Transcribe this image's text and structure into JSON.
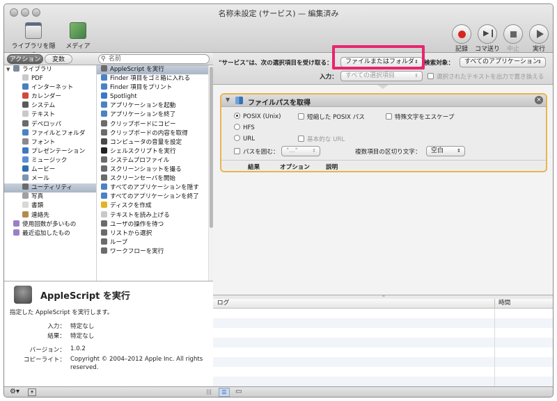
{
  "window": {
    "title": "名称未設定 (サービス) — 編集済み"
  },
  "toolbar": {
    "hide_library_label": "ライブラリを隠す",
    "media_label": "メディア",
    "record_label": "記録",
    "step_label": "コマ送り",
    "stop_label": "中止",
    "run_label": "実行"
  },
  "library": {
    "actions_tab": "アクション",
    "variables_tab": "変数",
    "search_placeholder": "名前",
    "categories": [
      {
        "label": "ライブラリ",
        "icon": "library-icon",
        "color": "#7c8aa0"
      },
      {
        "label": "PDF",
        "icon": "pdf-icon",
        "color": "#c9c9c9"
      },
      {
        "label": "インターネット",
        "icon": "internet-icon",
        "color": "#4a7fc1"
      },
      {
        "label": "カレンダー",
        "icon": "calendar-icon",
        "color": "#d04a3a"
      },
      {
        "label": "システム",
        "icon": "system-icon",
        "color": "#5a5a5a"
      },
      {
        "label": "テキスト",
        "icon": "text-icon",
        "color": "#c9c9c9"
      },
      {
        "label": "デベロッパ",
        "icon": "developer-icon",
        "color": "#6b6b6b"
      },
      {
        "label": "ファイルとフォルダ",
        "icon": "finder-icon",
        "color": "#4b82c4"
      },
      {
        "label": "フォント",
        "icon": "font-icon",
        "color": "#8a8a8a"
      },
      {
        "label": "プレゼンテーション",
        "icon": "presentation-icon",
        "color": "#3f78c2"
      },
      {
        "label": "ミュージック",
        "icon": "music-icon",
        "color": "#5a8fd6"
      },
      {
        "label": "ムービー",
        "icon": "movie-icon",
        "color": "#2d6eb0"
      },
      {
        "label": "メール",
        "icon": "mail-icon",
        "color": "#7d94b5"
      },
      {
        "label": "ユーティリティ",
        "icon": "utility-icon",
        "color": "#6b6b6b"
      },
      {
        "label": "写真",
        "icon": "photo-icon",
        "color": "#a0a0a0"
      },
      {
        "label": "書類",
        "icon": "document-icon",
        "color": "#d8d8d8"
      },
      {
        "label": "連絡先",
        "icon": "contacts-icon",
        "color": "#b58a4a"
      },
      {
        "label": "使用回数が多いもの",
        "icon": "smart-folder-icon",
        "color": "#9b7fc6"
      },
      {
        "label": "最近追加したもの",
        "icon": "smart-folder-icon",
        "color": "#9b7fc6"
      }
    ],
    "selected_category": "ユーティリティ",
    "actions": [
      {
        "label": "AppleScript を実行",
        "icon": "applescript-icon",
        "color": "#6b6b6b"
      },
      {
        "label": "Finder 項目をゴミ箱に入れる",
        "icon": "finder-icon",
        "color": "#4b82c4"
      },
      {
        "label": "Finder 項目をプリント",
        "icon": "finder-icon",
        "color": "#4b82c4"
      },
      {
        "label": "Spotlight",
        "icon": "spotlight-icon",
        "color": "#3b78c9"
      },
      {
        "label": "アプリケーションを起動",
        "icon": "finder-icon",
        "color": "#4b82c4"
      },
      {
        "label": "アプリケーションを終了",
        "icon": "finder-icon",
        "color": "#4b82c4"
      },
      {
        "label": "クリップボードにコピー",
        "icon": "tools-icon",
        "color": "#6b6b6b"
      },
      {
        "label": "クリップボードの内容を取得",
        "icon": "tools-icon",
        "color": "#6b6b6b"
      },
      {
        "label": "コンピュータの音量を設定",
        "icon": "terminal-icon",
        "color": "#4a4a4a"
      },
      {
        "label": "シェルスクリプトを実行",
        "icon": "terminal-icon",
        "color": "#222222"
      },
      {
        "label": "システムプロファイル",
        "icon": "tools-icon",
        "color": "#6b6b6b"
      },
      {
        "label": "スクリーンショットを撮る",
        "icon": "tools-icon",
        "color": "#6b6b6b"
      },
      {
        "label": "スクリーンセーバを開始",
        "icon": "tools-icon",
        "color": "#6b6b6b"
      },
      {
        "label": "すべてのアプリケーションを隠す",
        "icon": "finder-icon",
        "color": "#4b82c4"
      },
      {
        "label": "すべてのアプリケーションを終了",
        "icon": "finder-icon",
        "color": "#4b82c4"
      },
      {
        "label": "ディスクを作成",
        "icon": "hazard-icon",
        "color": "#e3b323"
      },
      {
        "label": "テキストを読み上げる",
        "icon": "text-icon",
        "color": "#c9c9c9"
      },
      {
        "label": "ユーザの操作を待つ",
        "icon": "applescript-icon",
        "color": "#6b6b6b"
      },
      {
        "label": "リストから選択",
        "icon": "applescript-icon",
        "color": "#6b6b6b"
      },
      {
        "label": "ループ",
        "icon": "applescript-icon",
        "color": "#6b6b6b"
      },
      {
        "label": "ワークフローを実行",
        "icon": "applescript-icon",
        "color": "#6b6b6b"
      }
    ],
    "selected_action": "AppleScript を実行"
  },
  "info": {
    "title": "AppleScript を実行",
    "description": "指定した AppleScript を実行します。",
    "input_label": "入力：",
    "input_value": "特定なし",
    "result_label": "結果：",
    "result_value": "特定なし",
    "version_label": "バージョン：",
    "version_value": "1.0.2",
    "copyright_label": "コピーライト：",
    "copyright_value": "Copyright © 2004–2012 Apple Inc.  All rights reserved."
  },
  "service": {
    "receives_label": "\"サービス\"は、次の選択項目を受け取る：",
    "receives_value": "ファイルまたはフォルダ",
    "target_label": "検索対象：",
    "target_value": "すべてのアプリケーション",
    "input_label": "入力：",
    "input_value": "すべての選択項目",
    "output_label": "選択されたテキストを出力で置き換える"
  },
  "action_card": {
    "title": "ファイルパスを取得",
    "posix_label": "POSIX (Unix)",
    "short_posix_label": "短縮した POSIX パス",
    "escape_label": "特殊文字をエスケープ",
    "hfs_label": "HFS",
    "url_label": "URL",
    "base_url_label": "基本的な URL",
    "wrap_label": "パスを囲む：",
    "wrap_value": "\"...\"",
    "separator_label": "複数項目の区切り文字：",
    "separator_value": "空白",
    "footer_result": "結果",
    "footer_options": "オプション",
    "footer_description": "説明"
  },
  "log": {
    "col_log": "ログ",
    "col_time": "時間"
  },
  "colors": {
    "highlight": "#e8256f",
    "card_border": "#e7b64c",
    "record": "#d8261f"
  }
}
